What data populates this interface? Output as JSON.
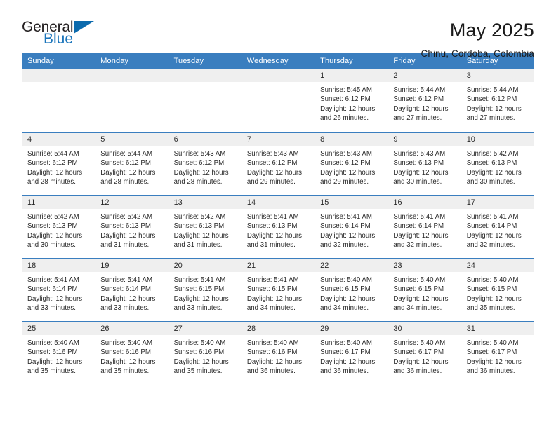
{
  "brand": {
    "name_part1": "General",
    "name_part2": "Blue",
    "accent_color": "#1b75bb",
    "triangle_color": "#0b6aad"
  },
  "header": {
    "title": "May 2025",
    "subtitle": "Chinu, Cordoba, Colombia"
  },
  "calendar": {
    "header_bg": "#3a7ebf",
    "daynum_bg": "#efefef",
    "weekday_headers": [
      "Sunday",
      "Monday",
      "Tuesday",
      "Wednesday",
      "Thursday",
      "Friday",
      "Saturday"
    ],
    "weeks": [
      [
        {
          "day": "",
          "empty": true
        },
        {
          "day": "",
          "empty": true
        },
        {
          "day": "",
          "empty": true
        },
        {
          "day": "",
          "empty": true
        },
        {
          "day": "1",
          "sunrise": "Sunrise: 5:45 AM",
          "sunset": "Sunset: 6:12 PM",
          "daylight_1": "Daylight: 12 hours",
          "daylight_2": "and 26 minutes."
        },
        {
          "day": "2",
          "sunrise": "Sunrise: 5:44 AM",
          "sunset": "Sunset: 6:12 PM",
          "daylight_1": "Daylight: 12 hours",
          "daylight_2": "and 27 minutes."
        },
        {
          "day": "3",
          "sunrise": "Sunrise: 5:44 AM",
          "sunset": "Sunset: 6:12 PM",
          "daylight_1": "Daylight: 12 hours",
          "daylight_2": "and 27 minutes."
        }
      ],
      [
        {
          "day": "4",
          "sunrise": "Sunrise: 5:44 AM",
          "sunset": "Sunset: 6:12 PM",
          "daylight_1": "Daylight: 12 hours",
          "daylight_2": "and 28 minutes."
        },
        {
          "day": "5",
          "sunrise": "Sunrise: 5:44 AM",
          "sunset": "Sunset: 6:12 PM",
          "daylight_1": "Daylight: 12 hours",
          "daylight_2": "and 28 minutes."
        },
        {
          "day": "6",
          "sunrise": "Sunrise: 5:43 AM",
          "sunset": "Sunset: 6:12 PM",
          "daylight_1": "Daylight: 12 hours",
          "daylight_2": "and 28 minutes."
        },
        {
          "day": "7",
          "sunrise": "Sunrise: 5:43 AM",
          "sunset": "Sunset: 6:12 PM",
          "daylight_1": "Daylight: 12 hours",
          "daylight_2": "and 29 minutes."
        },
        {
          "day": "8",
          "sunrise": "Sunrise: 5:43 AM",
          "sunset": "Sunset: 6:12 PM",
          "daylight_1": "Daylight: 12 hours",
          "daylight_2": "and 29 minutes."
        },
        {
          "day": "9",
          "sunrise": "Sunrise: 5:43 AM",
          "sunset": "Sunset: 6:13 PM",
          "daylight_1": "Daylight: 12 hours",
          "daylight_2": "and 30 minutes."
        },
        {
          "day": "10",
          "sunrise": "Sunrise: 5:42 AM",
          "sunset": "Sunset: 6:13 PM",
          "daylight_1": "Daylight: 12 hours",
          "daylight_2": "and 30 minutes."
        }
      ],
      [
        {
          "day": "11",
          "sunrise": "Sunrise: 5:42 AM",
          "sunset": "Sunset: 6:13 PM",
          "daylight_1": "Daylight: 12 hours",
          "daylight_2": "and 30 minutes."
        },
        {
          "day": "12",
          "sunrise": "Sunrise: 5:42 AM",
          "sunset": "Sunset: 6:13 PM",
          "daylight_1": "Daylight: 12 hours",
          "daylight_2": "and 31 minutes."
        },
        {
          "day": "13",
          "sunrise": "Sunrise: 5:42 AM",
          "sunset": "Sunset: 6:13 PM",
          "daylight_1": "Daylight: 12 hours",
          "daylight_2": "and 31 minutes."
        },
        {
          "day": "14",
          "sunrise": "Sunrise: 5:41 AM",
          "sunset": "Sunset: 6:13 PM",
          "daylight_1": "Daylight: 12 hours",
          "daylight_2": "and 31 minutes."
        },
        {
          "day": "15",
          "sunrise": "Sunrise: 5:41 AM",
          "sunset": "Sunset: 6:14 PM",
          "daylight_1": "Daylight: 12 hours",
          "daylight_2": "and 32 minutes."
        },
        {
          "day": "16",
          "sunrise": "Sunrise: 5:41 AM",
          "sunset": "Sunset: 6:14 PM",
          "daylight_1": "Daylight: 12 hours",
          "daylight_2": "and 32 minutes."
        },
        {
          "day": "17",
          "sunrise": "Sunrise: 5:41 AM",
          "sunset": "Sunset: 6:14 PM",
          "daylight_1": "Daylight: 12 hours",
          "daylight_2": "and 32 minutes."
        }
      ],
      [
        {
          "day": "18",
          "sunrise": "Sunrise: 5:41 AM",
          "sunset": "Sunset: 6:14 PM",
          "daylight_1": "Daylight: 12 hours",
          "daylight_2": "and 33 minutes."
        },
        {
          "day": "19",
          "sunrise": "Sunrise: 5:41 AM",
          "sunset": "Sunset: 6:14 PM",
          "daylight_1": "Daylight: 12 hours",
          "daylight_2": "and 33 minutes."
        },
        {
          "day": "20",
          "sunrise": "Sunrise: 5:41 AM",
          "sunset": "Sunset: 6:15 PM",
          "daylight_1": "Daylight: 12 hours",
          "daylight_2": "and 33 minutes."
        },
        {
          "day": "21",
          "sunrise": "Sunrise: 5:41 AM",
          "sunset": "Sunset: 6:15 PM",
          "daylight_1": "Daylight: 12 hours",
          "daylight_2": "and 34 minutes."
        },
        {
          "day": "22",
          "sunrise": "Sunrise: 5:40 AM",
          "sunset": "Sunset: 6:15 PM",
          "daylight_1": "Daylight: 12 hours",
          "daylight_2": "and 34 minutes."
        },
        {
          "day": "23",
          "sunrise": "Sunrise: 5:40 AM",
          "sunset": "Sunset: 6:15 PM",
          "daylight_1": "Daylight: 12 hours",
          "daylight_2": "and 34 minutes."
        },
        {
          "day": "24",
          "sunrise": "Sunrise: 5:40 AM",
          "sunset": "Sunset: 6:15 PM",
          "daylight_1": "Daylight: 12 hours",
          "daylight_2": "and 35 minutes."
        }
      ],
      [
        {
          "day": "25",
          "sunrise": "Sunrise: 5:40 AM",
          "sunset": "Sunset: 6:16 PM",
          "daylight_1": "Daylight: 12 hours",
          "daylight_2": "and 35 minutes."
        },
        {
          "day": "26",
          "sunrise": "Sunrise: 5:40 AM",
          "sunset": "Sunset: 6:16 PM",
          "daylight_1": "Daylight: 12 hours",
          "daylight_2": "and 35 minutes."
        },
        {
          "day": "27",
          "sunrise": "Sunrise: 5:40 AM",
          "sunset": "Sunset: 6:16 PM",
          "daylight_1": "Daylight: 12 hours",
          "daylight_2": "and 35 minutes."
        },
        {
          "day": "28",
          "sunrise": "Sunrise: 5:40 AM",
          "sunset": "Sunset: 6:16 PM",
          "daylight_1": "Daylight: 12 hours",
          "daylight_2": "and 36 minutes."
        },
        {
          "day": "29",
          "sunrise": "Sunrise: 5:40 AM",
          "sunset": "Sunset: 6:17 PM",
          "daylight_1": "Daylight: 12 hours",
          "daylight_2": "and 36 minutes."
        },
        {
          "day": "30",
          "sunrise": "Sunrise: 5:40 AM",
          "sunset": "Sunset: 6:17 PM",
          "daylight_1": "Daylight: 12 hours",
          "daylight_2": "and 36 minutes."
        },
        {
          "day": "31",
          "sunrise": "Sunrise: 5:40 AM",
          "sunset": "Sunset: 6:17 PM",
          "daylight_1": "Daylight: 12 hours",
          "daylight_2": "and 36 minutes."
        }
      ]
    ]
  }
}
